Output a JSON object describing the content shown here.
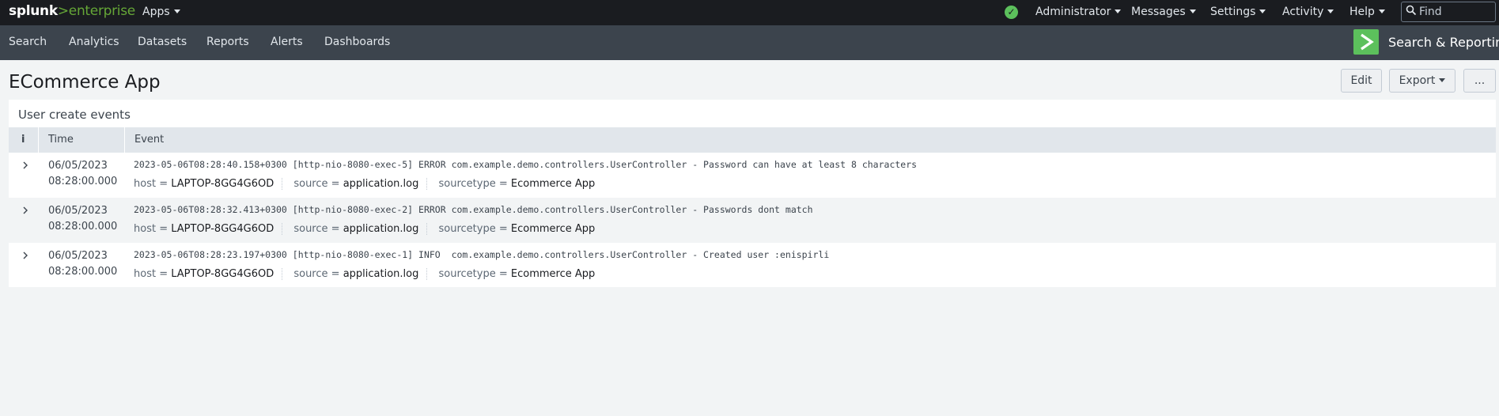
{
  "topbar": {
    "brand": "splunk",
    "separator": ">",
    "product": "enterprise",
    "apps_label": "Apps",
    "status": "ok",
    "menus": [
      "Administrator",
      "Messages",
      "Settings",
      "Activity",
      "Help"
    ],
    "find_placeholder": "Find"
  },
  "appbar": {
    "nav": [
      "Search",
      "Analytics",
      "Datasets",
      "Reports",
      "Alerts",
      "Dashboards"
    ],
    "app_title": "Search & Reporting",
    "app_icon_color": "#5cc05c"
  },
  "dashboard": {
    "title": "ECommerce App",
    "edit_label": "Edit",
    "export_label": "Export",
    "more_label": "..."
  },
  "panel": {
    "title": "User create events",
    "columns": [
      "i",
      "Time",
      "Event"
    ],
    "field_labels": {
      "host": "host =",
      "source": "source =",
      "sourcetype": "sourcetype ="
    },
    "events": [
      {
        "date": "06/05/2023",
        "time": "08:28:00.000",
        "raw": "2023-05-06T08:28:40.158+0300 [http-nio-8080-exec-5] ERROR com.example.demo.controllers.UserController - Password can have at least 8 characters",
        "host": "LAPTOP-8GG4G6OD",
        "source": "application.log",
        "sourcetype": "Ecommerce App"
      },
      {
        "date": "06/05/2023",
        "time": "08:28:00.000",
        "raw": "2023-05-06T08:28:32.413+0300 [http-nio-8080-exec-2] ERROR com.example.demo.controllers.UserController - Passwords dont match",
        "host": "LAPTOP-8GG4G6OD",
        "source": "application.log",
        "sourcetype": "Ecommerce App"
      },
      {
        "date": "06/05/2023",
        "time": "08:28:00.000",
        "raw": "2023-05-06T08:28:23.197+0300 [http-nio-8080-exec-1] INFO  com.example.demo.controllers.UserController - Created user :enispirli",
        "host": "LAPTOP-8GG4G6OD",
        "source": "application.log",
        "sourcetype": "Ecommerce App"
      }
    ]
  }
}
